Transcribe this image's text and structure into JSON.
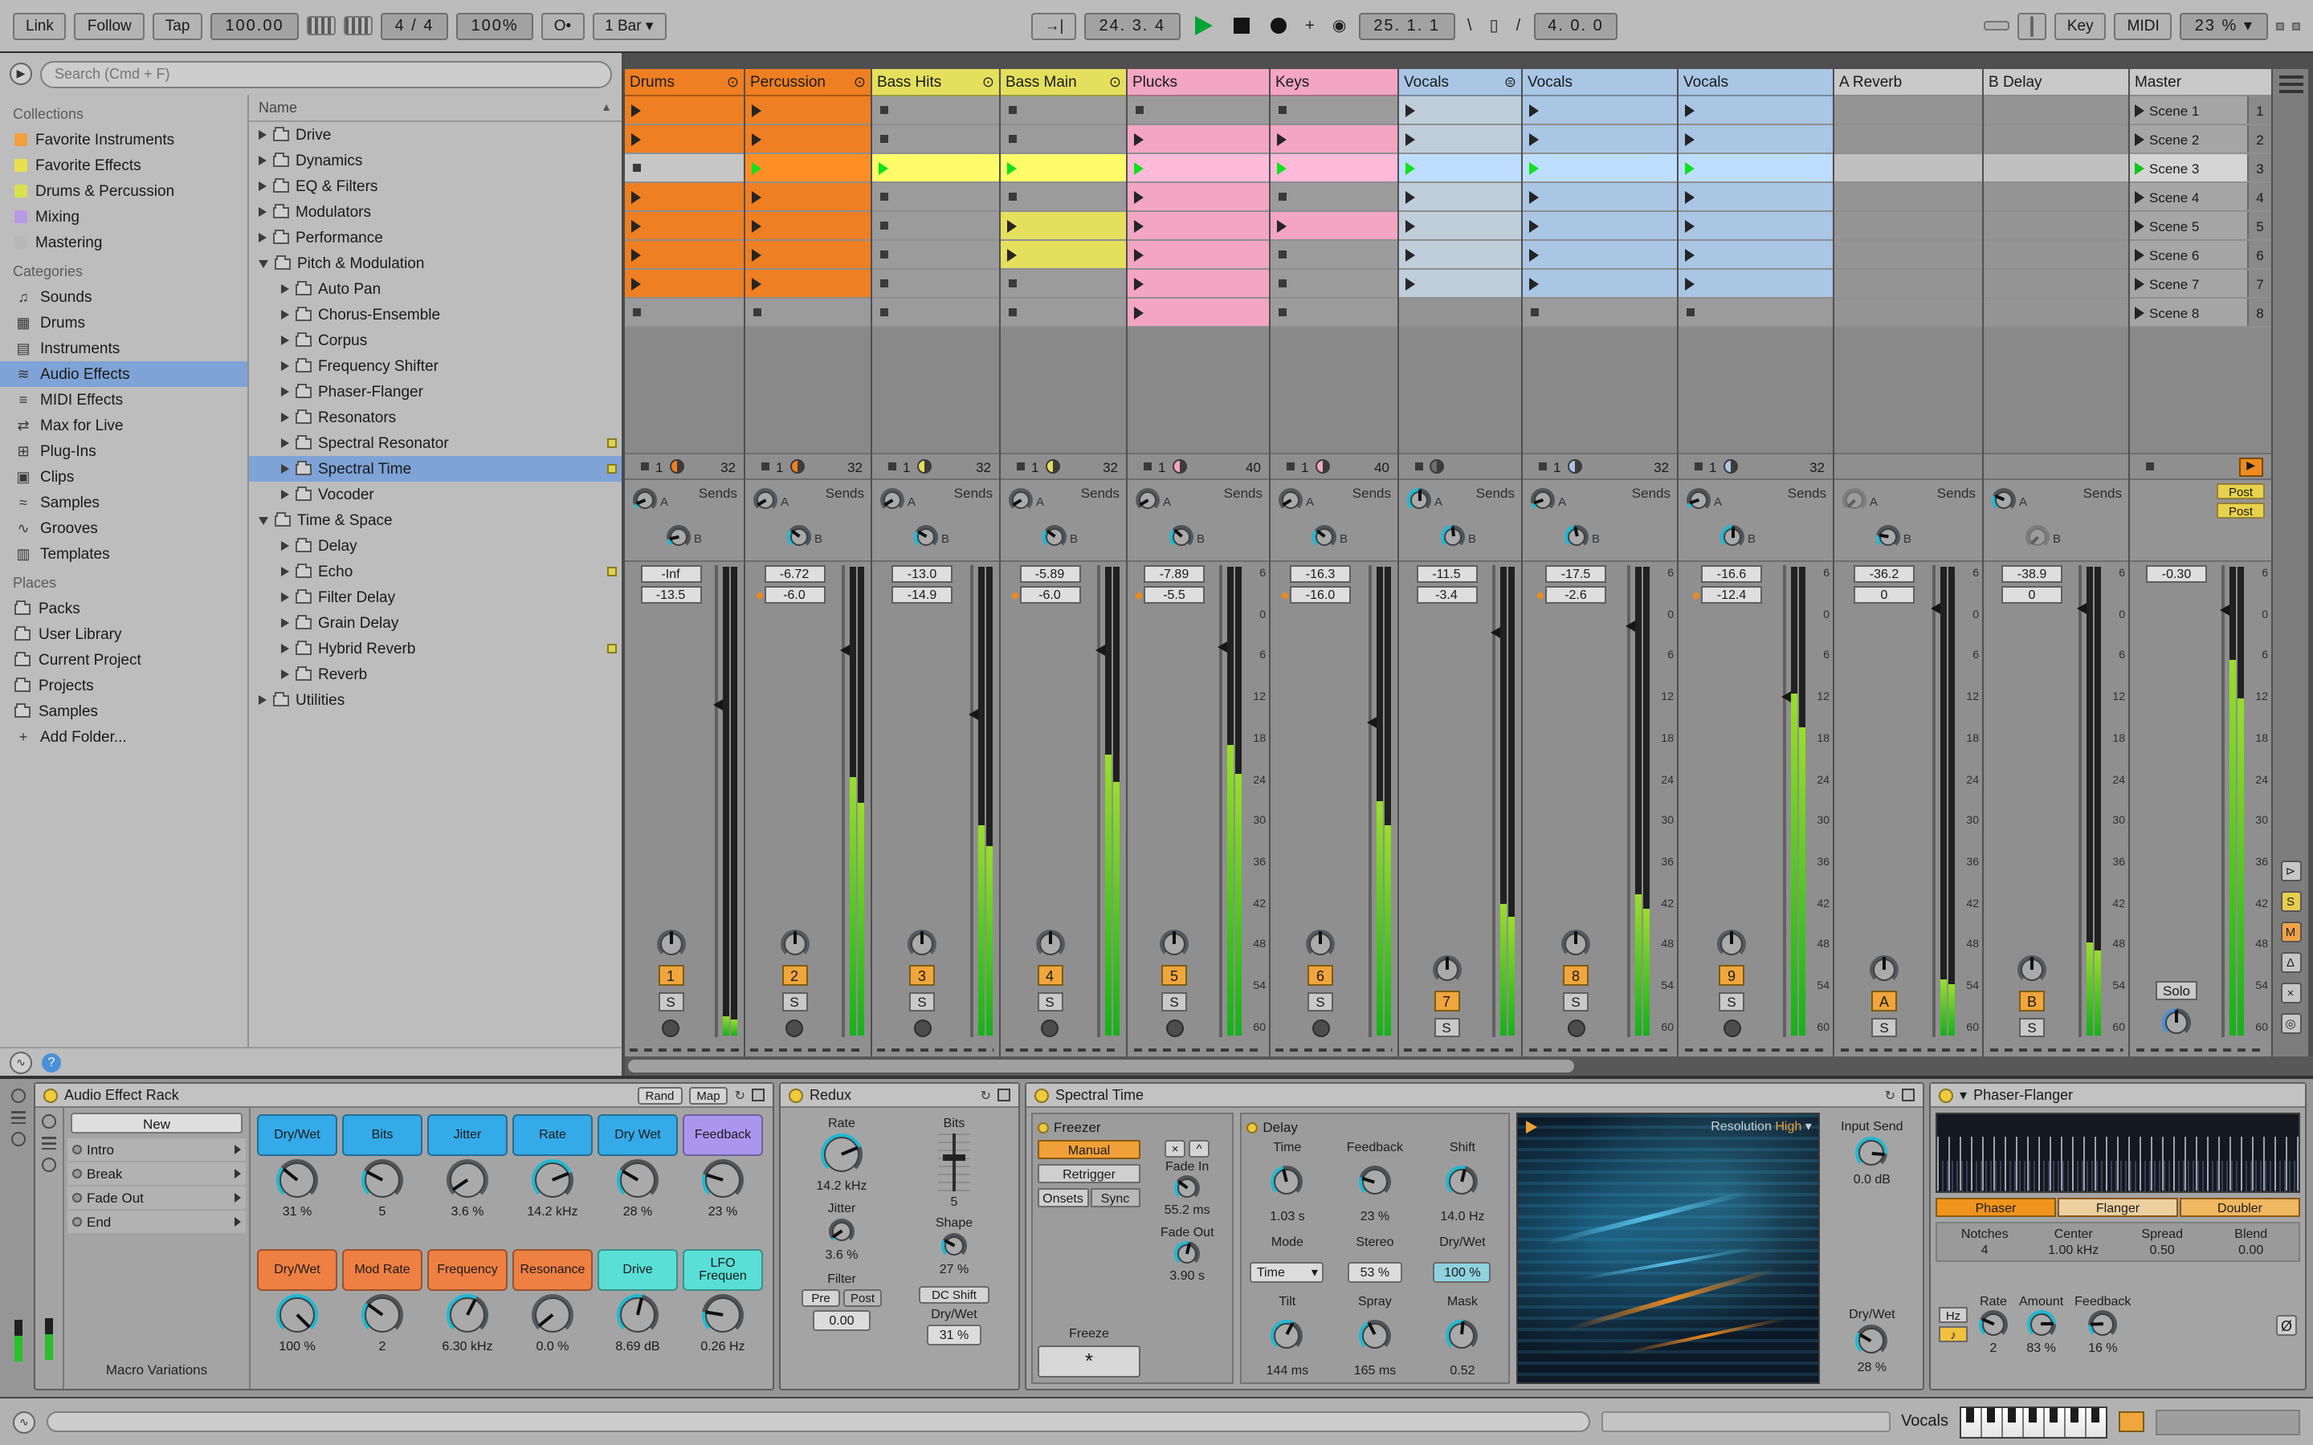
{
  "transport": {
    "link": "Link",
    "follow": "Follow",
    "tap": "Tap",
    "tempo": "100.00",
    "time_signature": "4 / 4",
    "global_quantize": "100%",
    "groove": "O•",
    "quantize_menu": "1 Bar",
    "position": "24. 3. 4",
    "loop_start": "25. 1. 1",
    "loop_length": "4. 0. 0",
    "key": "Key",
    "midi": "MIDI",
    "cpu": "23 %",
    "arrow": "→|"
  },
  "browser": {
    "search_placeholder": "Search (Cmd + F)",
    "tree_header": "Name",
    "sections": [
      {
        "title": "Collections",
        "items": [
          {
            "label": "Favorite Instruments",
            "swatch": "#f0a13c"
          },
          {
            "label": "Favorite Effects",
            "swatch": "#e8e04e"
          },
          {
            "label": "Drums & Percussion",
            "swatch": "#d6e24e"
          },
          {
            "label": "Mixing",
            "swatch": "#b79ae8"
          },
          {
            "label": "Mastering",
            "swatch": "#b8b8b8"
          }
        ]
      },
      {
        "title": "Categories",
        "items": [
          {
            "label": "Sounds",
            "glyph": "♫"
          },
          {
            "label": "Drums",
            "glyph": "▦"
          },
          {
            "label": "Instruments",
            "glyph": "▤"
          },
          {
            "label": "Audio Effects",
            "glyph": "≋",
            "selected": true
          },
          {
            "label": "MIDI Effects",
            "glyph": "≡"
          },
          {
            "label": "Max for Live",
            "glyph": "⇄"
          },
          {
            "label": "Plug-Ins",
            "glyph": "⊞"
          },
          {
            "label": "Clips",
            "glyph": "▣"
          },
          {
            "label": "Samples",
            "glyph": "≈"
          },
          {
            "label": "Grooves",
            "glyph": "∿"
          },
          {
            "label": "Templates",
            "glyph": "▥"
          }
        ]
      },
      {
        "title": "Places",
        "items": [
          {
            "label": "Packs",
            "folder": true
          },
          {
            "label": "User Library",
            "folder": true
          },
          {
            "label": "Current Project",
            "folder": true
          },
          {
            "label": "Projects",
            "folder": true
          },
          {
            "label": "Samples",
            "folder": true
          },
          {
            "label": "Add Folder...",
            "glyph": "+"
          }
        ]
      }
    ],
    "tree": [
      {
        "label": "Drive",
        "depth": 0
      },
      {
        "label": "Dynamics",
        "depth": 0
      },
      {
        "label": "EQ & Filters",
        "depth": 0
      },
      {
        "label": "Modulators",
        "depth": 0
      },
      {
        "label": "Performance",
        "depth": 0
      },
      {
        "label": "Pitch & Modulation",
        "depth": 0,
        "open": true
      },
      {
        "label": "Auto Pan",
        "depth": 1
      },
      {
        "label": "Chorus-Ensemble",
        "depth": 1
      },
      {
        "label": "Corpus",
        "depth": 1
      },
      {
        "label": "Frequency Shifter",
        "depth": 1
      },
      {
        "label": "Phaser-Flanger",
        "depth": 1
      },
      {
        "label": "Resonators",
        "depth": 1
      },
      {
        "label": "Spectral Resonator",
        "depth": 1,
        "dot": true
      },
      {
        "label": "Spectral Time",
        "depth": 1,
        "selected": true,
        "dot": true
      },
      {
        "label": "Vocoder",
        "depth": 1
      },
      {
        "label": "Time & Space",
        "depth": 0,
        "open": true
      },
      {
        "label": "Delay",
        "depth": 1
      },
      {
        "label": "Echo",
        "depth": 1,
        "dot": true
      },
      {
        "label": "Filter Delay",
        "depth": 1
      },
      {
        "label": "Grain Delay",
        "depth": 1
      },
      {
        "label": "Hybrid Reverb",
        "depth": 1,
        "dot": true
      },
      {
        "label": "Reverb",
        "depth": 1
      },
      {
        "label": "Utilities",
        "depth": 0
      }
    ]
  },
  "session": {
    "sends_label": "Sends",
    "send_a": "A",
    "send_b": "B",
    "solo": "S",
    "db_scale": [
      "6",
      "0",
      "6",
      "12",
      "18",
      "24",
      "30",
      "36",
      "42",
      "48",
      "54",
      "60"
    ],
    "selected_scene_index": 2,
    "scenes": [
      {
        "label": "Scene 1",
        "num": "1"
      },
      {
        "label": "Scene 2",
        "num": "2"
      },
      {
        "label": "Scene 3",
        "num": "3"
      },
      {
        "label": "Scene 4",
        "num": "4"
      },
      {
        "label": "Scene 5",
        "num": "5"
      },
      {
        "label": "Scene 6",
        "num": "6"
      },
      {
        "label": "Scene 7",
        "num": "7"
      },
      {
        "label": "Scene 8",
        "num": "8"
      }
    ],
    "tracks": [
      {
        "name": "Drums",
        "color": "#ee7f22",
        "num": "1",
        "peak": "-Inf",
        "vol": "-13.5",
        "fader": -13.5,
        "meter": 0.04,
        "width": 74,
        "clips": [
          "c",
          "c",
          "s",
          "c",
          "c",
          "c",
          "c",
          "s"
        ],
        "stop": {
          "pos": "1",
          "len": "32"
        },
        "sa": 0.08,
        "sb": 0.12,
        "arm": true,
        "fold": true
      },
      {
        "name": "Percussion",
        "color": "#ee7f22",
        "num": "2",
        "peak": "-6.72",
        "vol": "-6.0",
        "vol_dot": true,
        "fader": -6.0,
        "meter": 0.55,
        "width": 78,
        "clips": [
          "c",
          "c",
          "g",
          "c",
          "c",
          "c",
          "c",
          "s"
        ],
        "stop": {
          "pos": "1",
          "len": "32"
        },
        "sa": 0.05,
        "sb": 0.3,
        "arm": true,
        "fold": true
      },
      {
        "name": "Bass Hits",
        "color": "#e4e05e",
        "num": "3",
        "peak": "-13.0",
        "vol": "-14.9",
        "fader": -14.9,
        "meter": 0.45,
        "width": 79,
        "clips": [
          "s",
          "s",
          "g",
          "s",
          "s",
          "s",
          "s",
          "s"
        ],
        "stop": {
          "pos": "1",
          "len": "32"
        },
        "sa": 0.05,
        "sb": 0.28,
        "arm": true,
        "fold": true
      },
      {
        "name": "Bass Main",
        "color": "#e4e05e",
        "num": "4",
        "peak": "-5.89",
        "vol": "-6.0",
        "vol_dot": true,
        "fader": -6.0,
        "meter": 0.6,
        "width": 78,
        "clips": [
          "s",
          "s",
          "g",
          "s",
          "c",
          "c",
          "s",
          "s"
        ],
        "stop": {
          "pos": "1",
          "len": "32"
        },
        "sa": 0.05,
        "sb": 0.3,
        "arm": true,
        "fold": true
      },
      {
        "name": "Plucks",
        "color": "#f2a6c2",
        "num": "5",
        "peak": "-7.89",
        "vol": "-5.5",
        "vol_dot": true,
        "fader": -5.5,
        "meter": 0.62,
        "ruler": true,
        "width": 88,
        "clips": [
          "s",
          "c",
          "g",
          "c",
          "c",
          "c",
          "c",
          "c"
        ],
        "stop": {
          "pos": "1",
          "len": "40"
        },
        "sa": 0.05,
        "sb": 0.32,
        "arm": true
      },
      {
        "name": "Keys",
        "color": "#f2a6c2",
        "num": "6",
        "peak": "-16.3",
        "vol": "-16.0",
        "vol_dot": true,
        "fader": -16.0,
        "meter": 0.5,
        "width": 79,
        "clips": [
          "s",
          "c",
          "g",
          "s",
          "c",
          "s",
          "s",
          "s"
        ],
        "stop": {
          "pos": "1",
          "len": "40"
        },
        "sa": 0.05,
        "sb": 0.3,
        "arm": true
      },
      {
        "name": "Vocals",
        "color": "#a9c6e4",
        "num": "7",
        "peak": "-11.5",
        "vol": "-3.4",
        "fader": -3.4,
        "meter": 0.28,
        "width": 76,
        "clips": [
          "t",
          "t",
          "g",
          "t",
          "t",
          "t",
          "t",
          ""
        ],
        "stop": {
          "pie": true
        },
        "sa": 0.5,
        "sb": 0.48,
        "arm": false,
        "group": true
      },
      {
        "name": "Vocals",
        "color": "#a9c6e4",
        "num": "8",
        "peak": "-17.5",
        "vol": "-2.6",
        "vol_dot": true,
        "fader": -2.6,
        "meter": 0.3,
        "ruler": true,
        "width": 96,
        "clips": [
          "c",
          "c",
          "g",
          "c",
          "c",
          "c",
          "c",
          "s"
        ],
        "stop": {
          "pos": "1",
          "len": "32"
        },
        "sa": 0.1,
        "sb": 0.45,
        "arm": true
      },
      {
        "name": "Vocals",
        "color": "#a9c6e4",
        "num": "9",
        "peak": "-16.6",
        "vol": "-12.4",
        "vol_dot": true,
        "fader": -12.4,
        "meter": 0.73,
        "ruler": true,
        "width": 96,
        "clips": [
          "c",
          "c",
          "g",
          "c",
          "c",
          "c",
          "c",
          "s"
        ],
        "stop": {
          "pos": "1",
          "len": "32"
        },
        "sa": 0.1,
        "sb": 0.5,
        "arm": true
      },
      {
        "name": "A Reverb",
        "color": "#c9c9c9",
        "num": "A",
        "peak": "-36.2",
        "vol": "0",
        "fader": 0,
        "meter": 0.12,
        "ruler": true,
        "width": 92,
        "clips": [
          "",
          "",
          "",
          "",
          "",
          "",
          "",
          ""
        ],
        "stop": {},
        "sa": 0,
        "sb": 0.2,
        "arm": false,
        "ret": true,
        "dimA": true
      },
      {
        "name": "B Delay",
        "color": "#c9c9c9",
        "num": "B",
        "peak": "-38.9",
        "vol": "0",
        "fader": 0,
        "meter": 0.2,
        "ruler": true,
        "width": 90,
        "clips": [
          "",
          "",
          "",
          "",
          "",
          "",
          "",
          ""
        ],
        "stop": {},
        "sa": 0.25,
        "sb": 0,
        "arm": false,
        "ret": true,
        "dimB": true
      }
    ],
    "master": {
      "name": "Master",
      "color": "#c9c9c9",
      "vol": "-0.30",
      "fader": -0.3,
      "meter": 0.8,
      "solo": "Solo",
      "post_a": "Post",
      "post_b": "Post",
      "width": 88
    }
  },
  "mixer_toggles": [
    {
      "glyph": "⊳",
      "color": "#c6c6c6"
    },
    {
      "glyph": "S",
      "color": "#e6ce4c"
    },
    {
      "glyph": "M",
      "color": "#eda24a"
    },
    {
      "glyph": "Δ",
      "color": "#c6c6c6"
    },
    {
      "glyph": "×",
      "color": "#c6c6c6"
    },
    {
      "glyph": "◎",
      "color": "#c6c6c6"
    }
  ],
  "devices": {
    "rack": {
      "title": "Audio Effect Rack",
      "rand": "Rand",
      "map": "Map",
      "new_chain": "New",
      "chains": [
        "Intro",
        "Break",
        "Fade Out",
        "End"
      ],
      "macro_variations": "Macro Variations",
      "macros": [
        {
          "label": "Dry/Wet",
          "value": "31 %",
          "color": "#35aae8",
          "frac": 0.31
        },
        {
          "label": "Bits",
          "value": "5",
          "color": "#35aae8",
          "frac": 0.27
        },
        {
          "label": "Jitter",
          "value": "3.6 %",
          "color": "#35aae8",
          "frac": 0.04
        },
        {
          "label": "Rate",
          "value": "14.2 kHz",
          "color": "#35aae8",
          "frac": 0.75
        },
        {
          "label": "Dry Wet",
          "value": "28 %",
          "color": "#35aae8",
          "frac": 0.28
        },
        {
          "label": "Feedback",
          "value": "23 %",
          "color": "#ab96ee",
          "frac": 0.23
        },
        {
          "label": "Dry/Wet",
          "value": "100 %",
          "color": "#ef8043",
          "frac": 1.0
        },
        {
          "label": "Mod Rate",
          "value": "2",
          "color": "#ef8043",
          "frac": 0.3
        },
        {
          "label": "Frequency",
          "value": "6.30 kHz",
          "color": "#ef8043",
          "frac": 0.6
        },
        {
          "label": "Resonance",
          "value": "0.0 %",
          "color": "#ef8043",
          "frac": 0.02
        },
        {
          "label": "Drive",
          "value": "8.69 dB",
          "color": "#59dfd5",
          "frac": 0.55
        },
        {
          "label": "LFO Frequen",
          "value": "0.26 Hz",
          "color": "#59dfd5",
          "frac": 0.2
        }
      ]
    },
    "redux": {
      "title": "Redux",
      "rate_label": "Rate",
      "rate": "14.2 kHz",
      "jitter_label": "Jitter",
      "jitter": "3.6 %",
      "bits_label": "Bits",
      "bits": "5",
      "shape_label": "Shape",
      "shape": "27 %",
      "filter_label": "Filter",
      "pre": "Pre",
      "post": "Post",
      "filter_freq": "0.00",
      "dc_shift": "DC Shift",
      "drywet_label": "Dry/Wet",
      "drywet": "31 %"
    },
    "spectral": {
      "title": "Spectral Time",
      "freezer": {
        "label": "Freezer",
        "manual": "Manual",
        "retrigger": "Retrigger",
        "onsets": "Onsets",
        "sync": "Sync",
        "btn_x": "×",
        "btn_up": "^",
        "fade_in_label": "Fade In",
        "fade_in": "55.2 ms",
        "fade_out_label": "Fade Out",
        "fade_out": "3.90 s",
        "freeze_label": "Freeze",
        "freeze_glyph": "*"
      },
      "delay": {
        "label": "Delay",
        "time_label": "Time",
        "time": "1.03 s",
        "feedback_label": "Feedback",
        "feedback": "23 %",
        "shift_label": "Shift",
        "shift": "14.0 Hz",
        "mode_label": "Mode",
        "mode": "Time",
        "stereo_label": "Stereo",
        "stereo": "53 %",
        "drywet_label": "Dry/Wet",
        "drywet": "100 %",
        "tilt_label": "Tilt",
        "tilt": "144 ms",
        "spray_label": "Spray",
        "spray": "165 ms",
        "mask_label": "Mask",
        "mask": "0.52"
      },
      "display": {
        "resolution_label": "Resolution",
        "resolution": "High"
      },
      "output": {
        "input_send_label": "Input Send",
        "input_send": "0.0 dB",
        "drywet_label": "Dry/Wet",
        "drywet": "28 %"
      }
    },
    "phaser": {
      "title": "Phaser-Flanger",
      "tabs": [
        "Phaser",
        "Flanger",
        "Doubler"
      ],
      "notches_label": "Notches",
      "notches": "4",
      "center_label": "Center",
      "center": "1.00 kHz",
      "spread_label": "Spread",
      "spread": "0.50",
      "blend_label": "Blend",
      "blend": "0.00",
      "hz": "Hz",
      "note_glyph": "♪",
      "rate_label": "Rate",
      "rate": "2",
      "amount_label": "Amount",
      "amount": "83 %",
      "feedback_label": "Feedback",
      "feedback": "16 %",
      "phase_invert": "Ø"
    }
  },
  "statusbar": {
    "track": "Vocals"
  }
}
